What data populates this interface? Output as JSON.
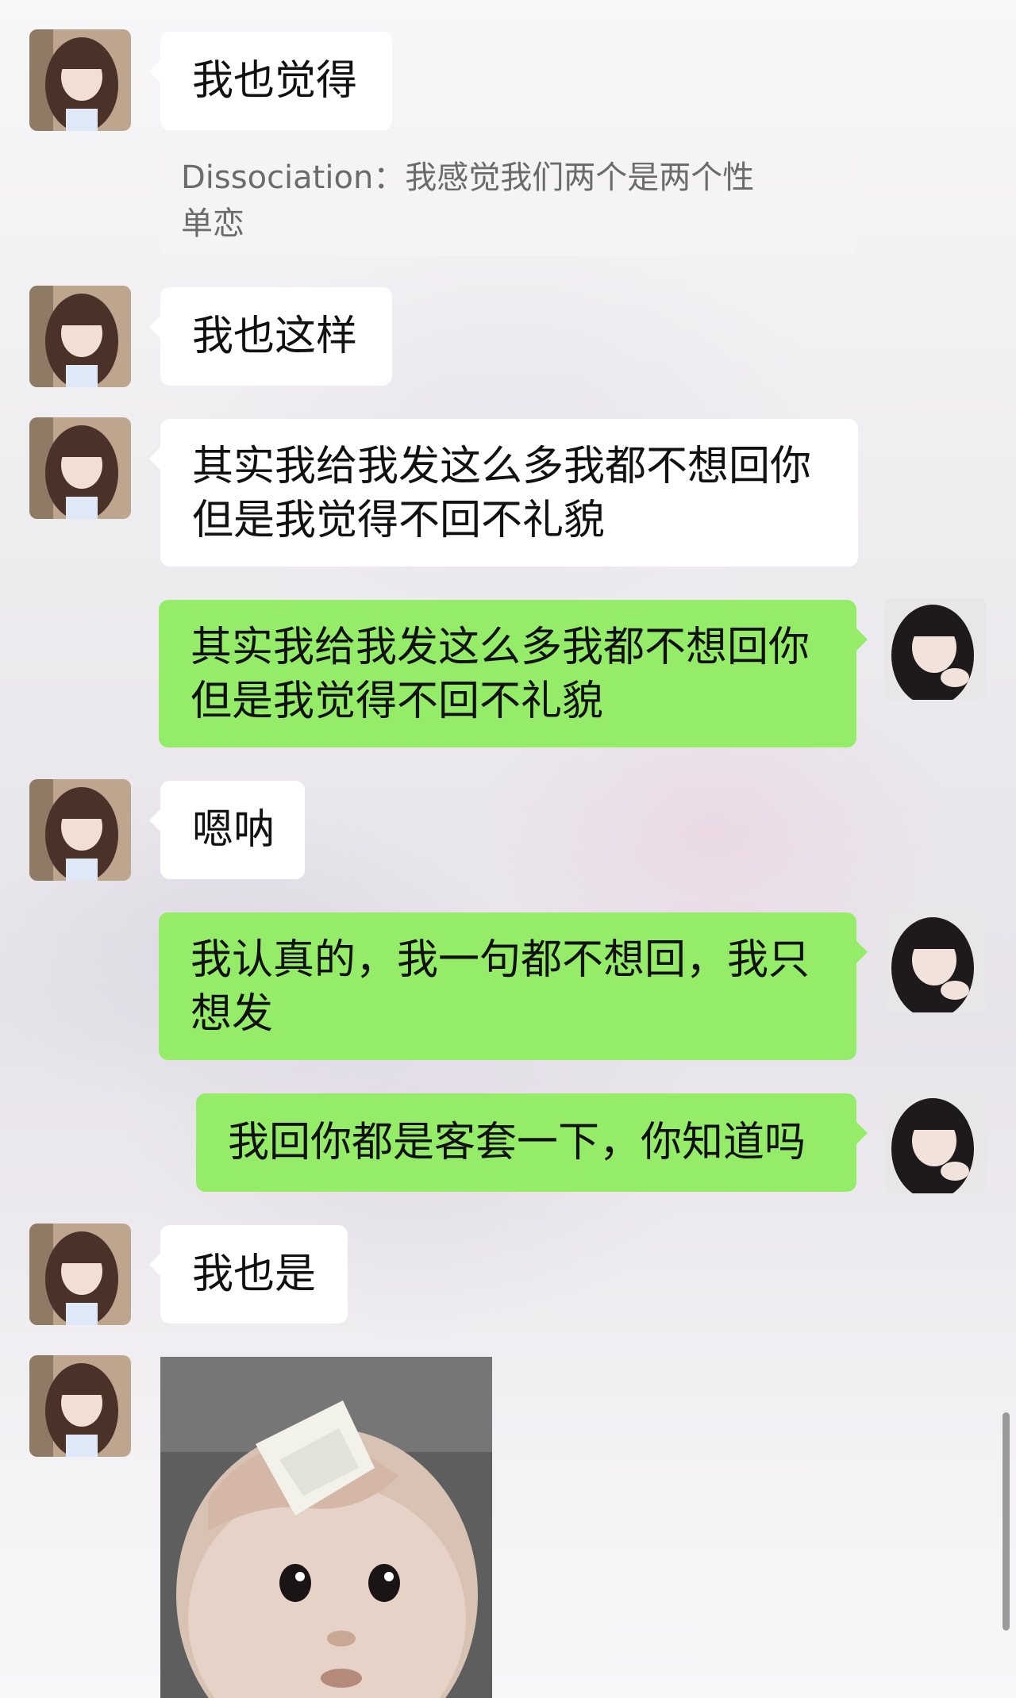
{
  "conversation": {
    "messages": [
      {
        "side": "left",
        "text": "我也觉得"
      },
      {
        "quote": "Dissociation：我感觉我们两个是两个性单恋"
      },
      {
        "side": "left",
        "text": "我也这样"
      },
      {
        "side": "left",
        "text": "其实我给我发这么多我都不想回你但是我觉得不回不礼貌"
      },
      {
        "side": "right",
        "text": "其实我给我发这么多我都不想回你但是我觉得不回不礼貌"
      },
      {
        "side": "left",
        "text": "嗯呐"
      },
      {
        "side": "right",
        "text": "我认真的，我一句都不想回，我只想发"
      },
      {
        "side": "right",
        "text": "我回你都是客套一下，你知道吗"
      },
      {
        "side": "left",
        "text": "我也是"
      },
      {
        "side": "left",
        "sticker": "baby-wiping-forehead-sticker"
      }
    ],
    "lines": {
      "m1": "我也觉得",
      "quote_l1": "Dissociation：我感觉我们两个是两个性",
      "quote_l2": "单恋",
      "m2": "我也这样",
      "m3_l1": "其实我给我发这么多我都不想回你",
      "m3_l2": "但是我觉得不回不礼貌",
      "m4_l1": "其实我给我发这么多我都不想回你",
      "m4_l2": "但是我觉得不回不礼貌",
      "m5": "嗯呐",
      "m6_l1": "我认真的，我一句都不想回，我只",
      "m6_l2": "想发",
      "m7": "我回你都是客套一下，你知道吗",
      "m8": "我也是"
    }
  },
  "colors": {
    "self_bubble": "#95ec69",
    "other_bubble": "#ffffff",
    "quote_text": "#6b6b6b"
  }
}
